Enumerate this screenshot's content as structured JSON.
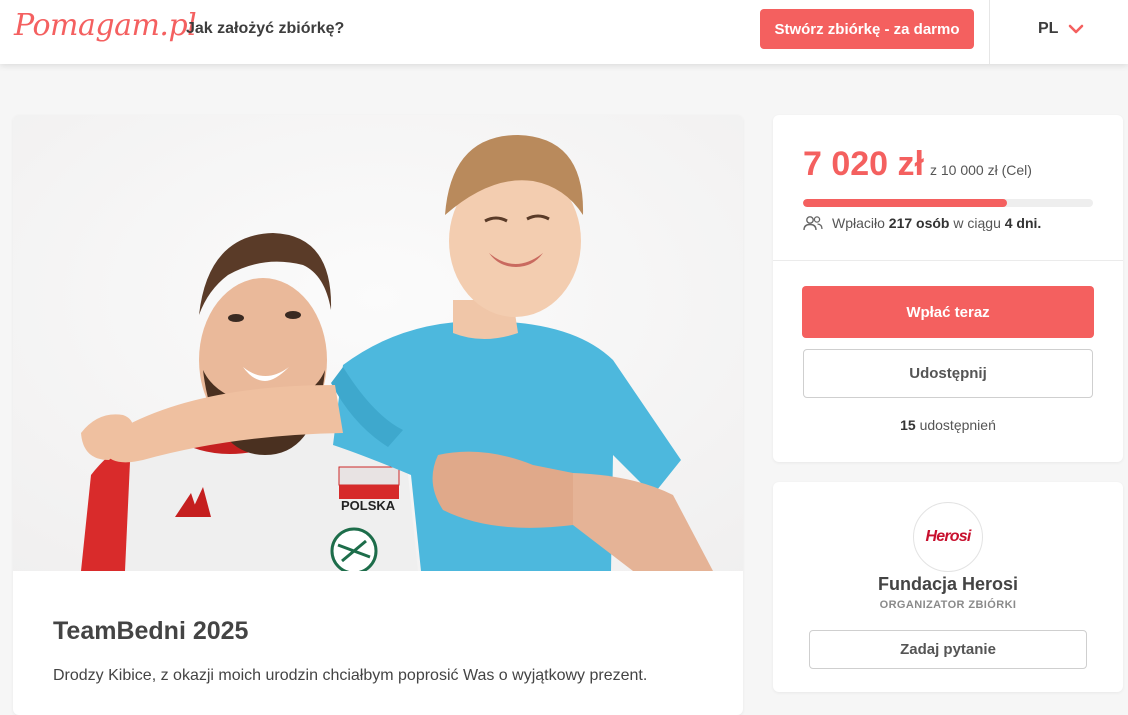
{
  "header": {
    "logo": "Pomagam.pl",
    "how_to_link": "Jak założyć zbiórkę?",
    "create_button": "Stwórz zbiórkę - za darmo",
    "language": "PL"
  },
  "campaign": {
    "title": "TeamBedni 2025",
    "description": "Drodzy Kibice, z okazji moich urodzin chciałbym poprosić Was o wyjątkowy prezent.",
    "photo_jersey_text": "POLSKA"
  },
  "donation": {
    "raised": "7 020 zł",
    "goal": "z 10 000 zł (Cel)",
    "progress_fraction": 0.702,
    "donors_prefix": "Wpłaciło",
    "donors_count": "217 osób",
    "donors_mid": "w ciągu",
    "days": "4 dni.",
    "pay_button": "Wpłać teraz",
    "share_button": "Udostępnij",
    "shares_count": "15",
    "shares_label": "udostępnień"
  },
  "organizer": {
    "logo_text": "Herosi",
    "name": "Fundacja Herosi",
    "role": "ORGANIZATOR ZBIÓRKI",
    "ask_button": "Zadaj pytanie"
  },
  "colors": {
    "accent": "#f4605f",
    "background": "#f6f6f6"
  },
  "icons": [
    "chevron-down-icon",
    "people-icon"
  ]
}
